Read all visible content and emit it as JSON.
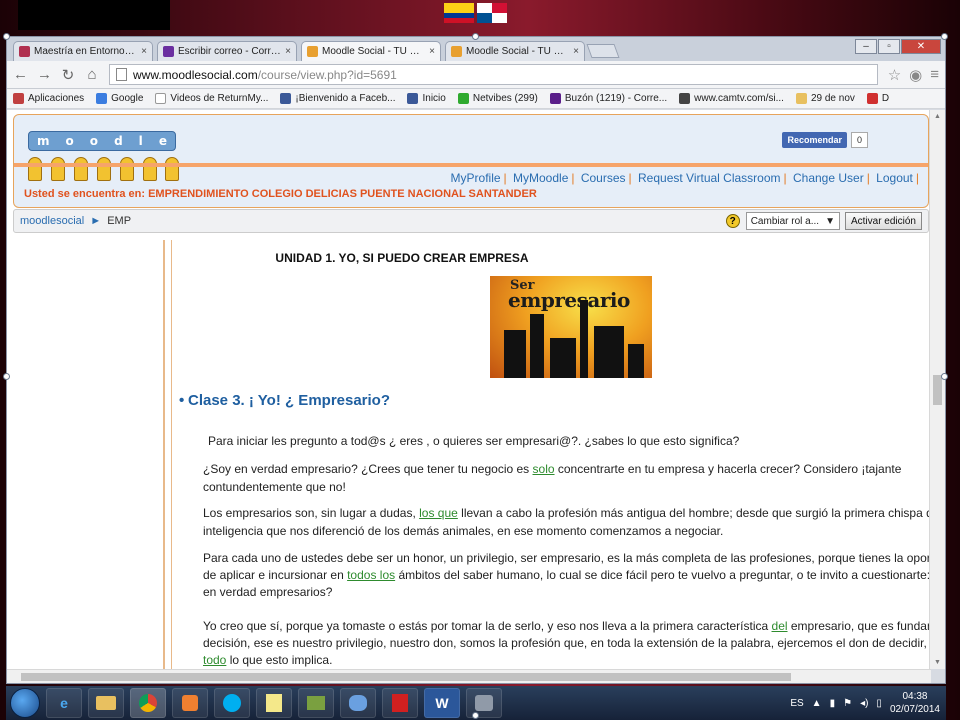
{
  "browser": {
    "tabs": [
      {
        "title": "Maestría en Entornos Virtu",
        "color": "#b03050"
      },
      {
        "title": "Escribir correo - Correo Ya",
        "color": "#6b2fa0"
      },
      {
        "title": "Moodle Social - TU COMU",
        "color": "#e8a030",
        "active": true
      },
      {
        "title": "Moodle Social - TU COMU",
        "color": "#e8a030"
      }
    ],
    "tab_close": "×",
    "url_host": "www.moodlesocial.com",
    "url_path": "/course/view.php?id=5691",
    "bookmarks": [
      {
        "label": "Aplicaciones",
        "color": "#c04040"
      },
      {
        "label": "Google",
        "color": "#3b7de0"
      },
      {
        "label": "Videos de ReturnMy...",
        "color": "#cccccc"
      },
      {
        "label": "¡Bienvenido a Faceb...",
        "color": "#3b5998"
      },
      {
        "label": "Inicio",
        "color": "#3b5998"
      },
      {
        "label": "Netvibes (299)",
        "color": "#2faa2f"
      },
      {
        "label": "Buzón (1219) - Corre...",
        "color": "#5a1e8a"
      },
      {
        "label": "www.camtv.com/si...",
        "color": "#444444"
      },
      {
        "label": "29 de nov",
        "color": "#e8c060"
      },
      {
        "label": "D",
        "color": "#d03030"
      }
    ]
  },
  "moodle": {
    "logo_letters": [
      "m",
      "o",
      "o",
      "d",
      "l",
      "e"
    ],
    "fb_like_label": "Recomendar",
    "fb_like_count": "0",
    "nav": [
      "MyProfile",
      "MyMoodle",
      "Courses",
      "Request Virtual Classroom",
      "Change User",
      "Logout"
    ],
    "location": "Usted se encuentra en: EMPRENDIMIENTO COLEGIO DELICIAS PUENTE NACIONAL SANTANDER",
    "breadcrumb_home": "moodlesocial",
    "breadcrumb_arrow": "►",
    "breadcrumb_current": "EMP",
    "help": "?",
    "role_select": "Cambiar rol a...",
    "edit_button": "Activar edición"
  },
  "content": {
    "unit_title": "UNIDAD 1. YO, SI  PUEDO CREAR EMPRESA",
    "banner_small": "Ser",
    "banner_big": "empresario",
    "class_title": "Clase 3. ¡ Yo! ¿ Empresario?",
    "p1": "Para iniciar  les  pregunto a tod@s ¿ eres , o quieres ser empresari@?. ¿sabes lo que esto significa?",
    "p2a": "¿Soy en verdad empresario? ¿Crees que tener tu negocio es ",
    "p2u": "solo",
    "p2b": " concentrarte en tu empresa y hacerla crecer? Considero ¡tajante",
    "p2c": "contundentemente que no!",
    "p3a": "Los empresarios son, sin lugar a dudas, ",
    "p3u": "los que",
    "p3b": " llevan  a cabo la profesión más antigua del hombre; desde que surgió la primera chispa d",
    "p3c": "inteligencia que nos diferenció de los demás animales, en ese momento comenzamos a negociar.",
    "p4a": "Para cada uno de ustedes debe ser un honor, un privilegio, ser empresario, es la más completa de las profesiones, porque tienes la oportunida",
    "p4b": "de aplicar e incursionar en ",
    "p4u": "todos los",
    "p4c": " ámbitos del saber humano, lo cual se dice fácil pero te vuelvo a preguntar, o te invito a cuestionarte: ¿som",
    "p4d": "en verdad empresarios?",
    "p5a": "Yo creo que sí, porque ya tomaste o estás por tomar la de serlo, y eso nos lleva a la primera característica ",
    "p5u": "del",
    "p5b": " empresario, que es fundamen",
    "p5c": "decisión, ese es nuestro privilegio, nuestro don, somos la profesión que, en toda la extensión de la palabra, ejercemos el don de decidir, ",
    "p5u2": "co",
    "p5u3": "todo",
    "p5d": " lo que esto implica."
  },
  "taskbar": {
    "language": "ES",
    "time": "04:38",
    "date": "02/07/2014",
    "apps": [
      "e",
      "",
      "",
      "",
      "",
      "",
      "",
      "",
      "W",
      ""
    ]
  }
}
